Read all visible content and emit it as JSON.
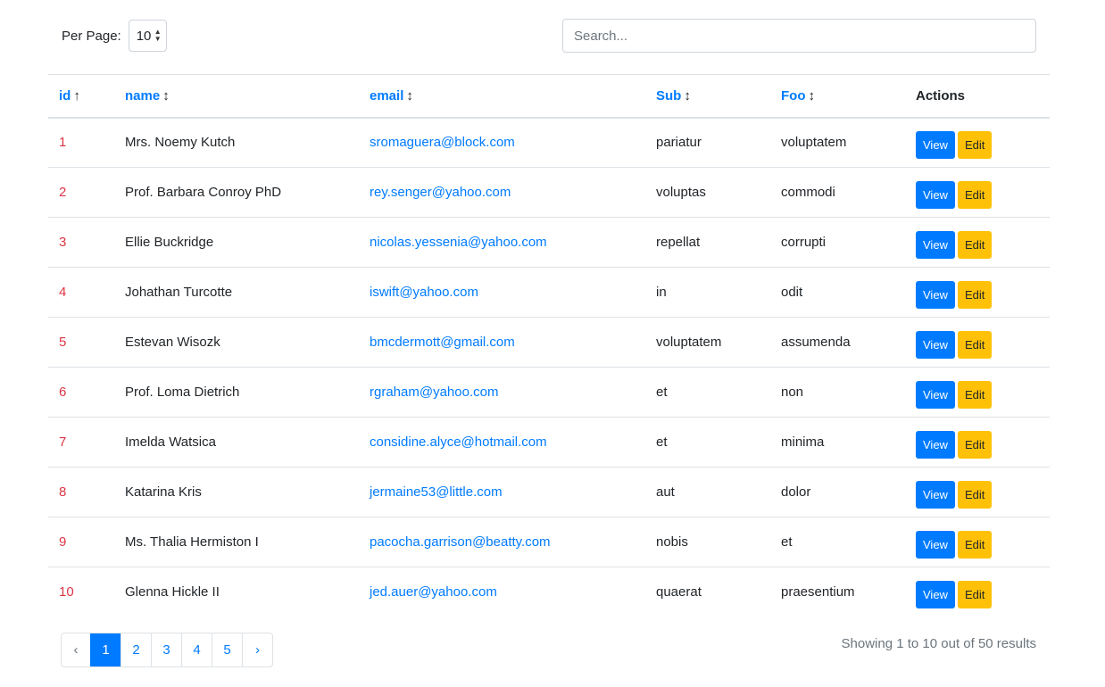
{
  "controls": {
    "per_page_label": "Per Page:",
    "per_page_value": "10",
    "search_placeholder": "Search..."
  },
  "table": {
    "headers": [
      {
        "label": "id",
        "sort": "↑"
      },
      {
        "label": "name",
        "sort": "↕"
      },
      {
        "label": "email",
        "sort": "↕"
      },
      {
        "label": "Sub",
        "sort": "↕"
      },
      {
        "label": "Foo",
        "sort": "↕"
      },
      {
        "label": "Actions",
        "sort": ""
      }
    ],
    "view_label": "View",
    "edit_label": "Edit",
    "rows": [
      {
        "id": "1",
        "name": "Mrs. Noemy Kutch",
        "email": "sromaguera@block.com",
        "sub": "pariatur",
        "foo": "voluptatem"
      },
      {
        "id": "2",
        "name": "Prof. Barbara Conroy PhD",
        "email": "rey.senger@yahoo.com",
        "sub": "voluptas",
        "foo": "commodi"
      },
      {
        "id": "3",
        "name": "Ellie Buckridge",
        "email": "nicolas.yessenia@yahoo.com",
        "sub": "repellat",
        "foo": "corrupti"
      },
      {
        "id": "4",
        "name": "Johathan Turcotte",
        "email": "iswift@yahoo.com",
        "sub": "in",
        "foo": "odit"
      },
      {
        "id": "5",
        "name": "Estevan Wisozk",
        "email": "bmcdermott@gmail.com",
        "sub": "voluptatem",
        "foo": "assumenda"
      },
      {
        "id": "6",
        "name": "Prof. Loma Dietrich",
        "email": "rgraham@yahoo.com",
        "sub": "et",
        "foo": "non"
      },
      {
        "id": "7",
        "name": "Imelda Watsica",
        "email": "considine.alyce@hotmail.com",
        "sub": "et",
        "foo": "minima"
      },
      {
        "id": "8",
        "name": "Katarina Kris",
        "email": "jermaine53@little.com",
        "sub": "aut",
        "foo": "dolor"
      },
      {
        "id": "9",
        "name": "Ms. Thalia Hermiston I",
        "email": "pacocha.garrison@beatty.com",
        "sub": "nobis",
        "foo": "et"
      },
      {
        "id": "10",
        "name": "Glenna Hickle II",
        "email": "jed.auer@yahoo.com",
        "sub": "quaerat",
        "foo": "praesentium"
      }
    ]
  },
  "pagination": {
    "prev": "‹",
    "next": "›",
    "pages": [
      "1",
      "2",
      "3",
      "4",
      "5"
    ],
    "active_page": "1"
  },
  "summary": "Showing 1 to 10 out of 50 results",
  "colors": {
    "primary": "#007bff",
    "warning": "#ffc107",
    "danger": "#dc3545",
    "muted": "#6c757d"
  }
}
